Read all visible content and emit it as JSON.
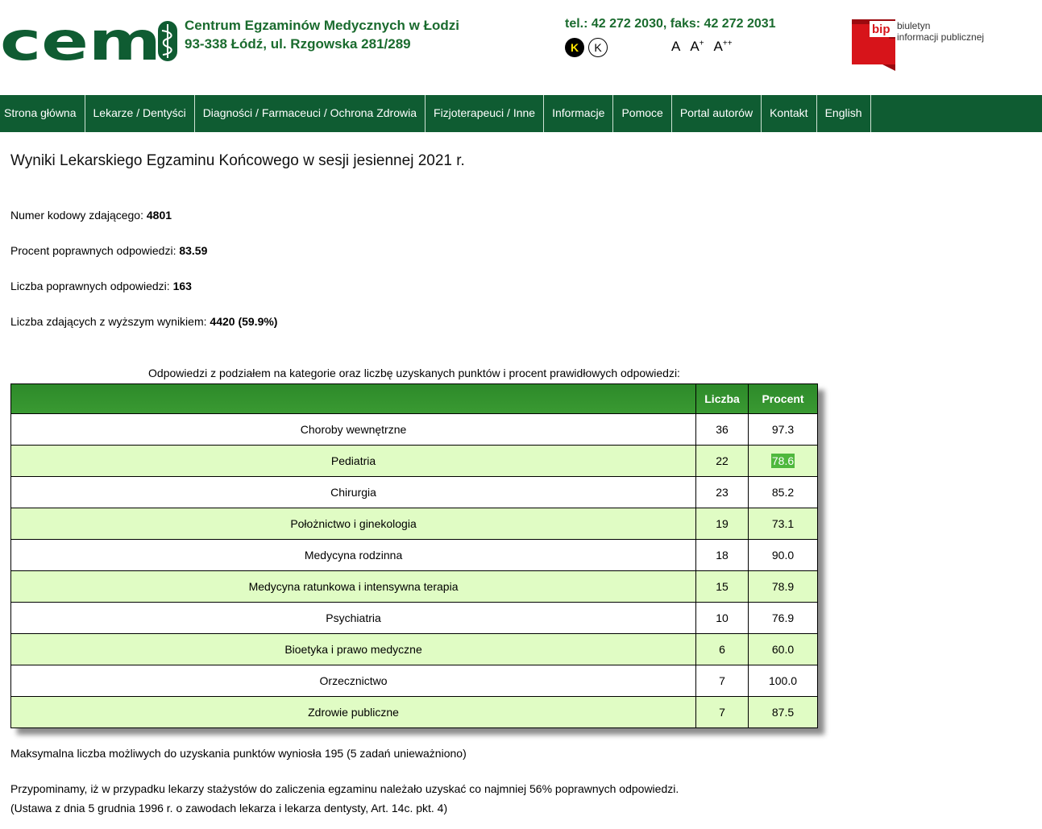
{
  "header": {
    "org_name": "Centrum Egzaminów Medycznych w Łodzi",
    "org_address": "93-338 Łódź, ul. Rzgowska 281/289",
    "phone_fax": "tel.: 42 272 2030, faks: 42 272 2031",
    "contrast_buttons": [
      "K",
      "K"
    ],
    "font_size_buttons": [
      {
        "label": "A",
        "sup": ""
      },
      {
        "label": "A",
        "sup": "+"
      },
      {
        "label": "A",
        "sup": "++"
      }
    ],
    "logo_text": "cem",
    "bip_badge": "bip",
    "bip_text_line1": "biuletyn",
    "bip_text_line2": "informacji publicznej"
  },
  "nav": {
    "items": [
      "Strona główna",
      "Lekarze / Dentyści",
      "Diagności / Farmaceuci / Ochrona Zdrowia",
      "Fizjoterapeuci / Inne",
      "Informacje",
      "Pomoce",
      "Portal autorów",
      "Kontakt",
      "English"
    ]
  },
  "main": {
    "title": "Wyniki Lekarskiego Egzaminu Końcowego w sesji jesiennej 2021 r.",
    "fields": [
      {
        "label": "Numer kodowy zdającego: ",
        "value": "4801"
      },
      {
        "label": "Procent poprawnych odpowiedzi: ",
        "value": "83.59"
      },
      {
        "label": "Liczba poprawnych odpowiedzi: ",
        "value": "163"
      },
      {
        "label": "Liczba zdających z wyższym wynikiem: ",
        "value": "4420 (59.9%)"
      }
    ],
    "table_caption": "Odpowiedzi z podziałem na kategorie oraz liczbę uzyskanych punktów i procent prawidłowych odpowiedzi:",
    "table": {
      "headers": [
        "",
        "Liczba",
        "Procent"
      ],
      "rows": [
        {
          "category": "Choroby wewnętrzne",
          "count": "36",
          "percent": "97.3"
        },
        {
          "category": "Pediatria",
          "count": "22",
          "percent": "78.6"
        },
        {
          "category": "Chirurgia",
          "count": "23",
          "percent": "85.2"
        },
        {
          "category": "Położnictwo i ginekologia",
          "count": "19",
          "percent": "73.1"
        },
        {
          "category": "Medycyna rodzinna",
          "count": "18",
          "percent": "90.0"
        },
        {
          "category": "Medycyna ratunkowa i intensywna terapia",
          "count": "15",
          "percent": "78.9"
        },
        {
          "category": "Psychiatria",
          "count": "10",
          "percent": "76.9"
        },
        {
          "category": "Bioetyka i prawo medyczne",
          "count": "6",
          "percent": "60.0"
        },
        {
          "category": "Orzecznictwo",
          "count": "7",
          "percent": "100.0"
        },
        {
          "category": "Zdrowie publiczne",
          "count": "7",
          "percent": "87.5"
        }
      ]
    },
    "notes": [
      "Maksymalna liczba możliwych do uzyskania punktów wyniosła 195 (5 zadań unieważniono)",
      "Przypominamy, iż w przypadku lekarzy stażystów do zaliczenia egzaminu należało uzyskać co najmniej 56% poprawnych odpowiedzi.",
      "(Ustawa z dnia 5 grudnia 1996 r. o zawodach lekarza i lekarza dentysty, Art. 14c. pkt. 4)"
    ]
  },
  "colors": {
    "brand_green": "#0f5c32",
    "header_text_green": "#1a6b2e",
    "row_alt": "#e0fcc4",
    "highlight": "#4fb83d",
    "bip_red": "#d7141a"
  }
}
